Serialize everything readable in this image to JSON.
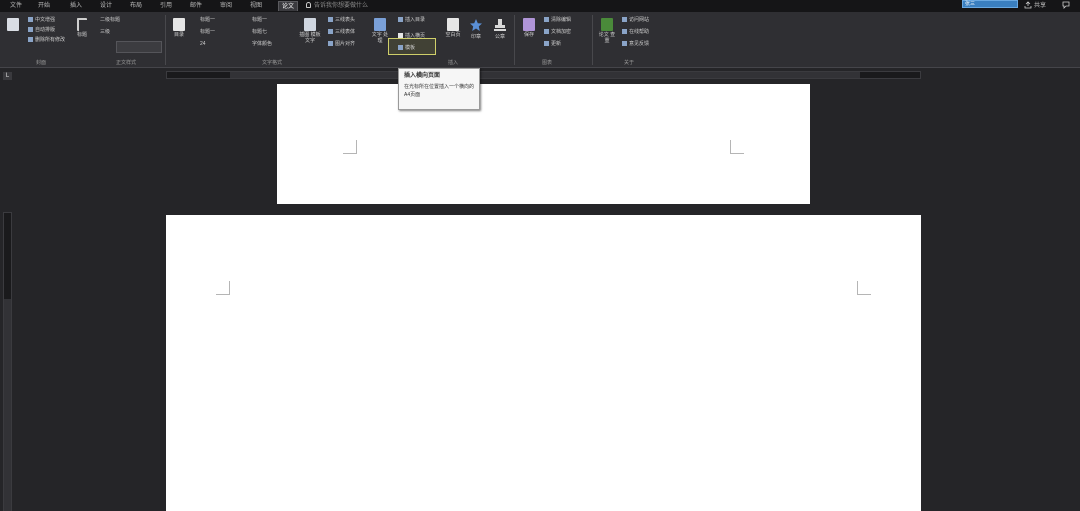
{
  "tabs": [
    {
      "label": "文件",
      "active": false
    },
    {
      "label": "开始",
      "active": false
    },
    {
      "label": "插入",
      "active": false
    },
    {
      "label": "设计",
      "active": false
    },
    {
      "label": "布局",
      "active": false
    },
    {
      "label": "引用",
      "active": false
    },
    {
      "label": "邮件",
      "active": false
    },
    {
      "label": "审阅",
      "active": false
    },
    {
      "label": "视图",
      "active": false
    },
    {
      "label": "论文",
      "active": true
    }
  ],
  "tell_me": "告诉我你想要做什么",
  "share": {
    "label": "共享",
    "user": "张三"
  },
  "ribbon": {
    "col1": {
      "big_label": "同源\n仿真",
      "items": [
        "中文增强",
        "自动排版",
        "删除所有修改"
      ]
    },
    "col2": {
      "big_label": "标题",
      "items": [
        "二级标题",
        "三级"
      ],
      "font_box": ""
    },
    "col3": {
      "big_label": "目录",
      "items": [
        "标题一",
        "标题一",
        "24"
      ]
    },
    "col4": {
      "items": [
        "标题一",
        "标题七",
        "字体颜色"
      ]
    },
    "col5": {
      "big_label": "插图\n模板文字",
      "items": [
        "三线表头",
        "三线表体",
        "图片对齐"
      ]
    },
    "col6": {
      "big_label": "文字\n处理",
      "items": [
        "插入目录",
        "插入横页",
        "模板"
      ],
      "highlight": "插入横页"
    },
    "col7": {
      "big_label": "空白页"
    },
    "col8": {
      "big_label": "印章"
    },
    "col9": {
      "big_label": "公章"
    },
    "col10": {
      "big_label": "保存",
      "items": [
        "清除编辑",
        "文档加密",
        "更新"
      ]
    },
    "col11": {
      "big_label": "论文\n查重",
      "items": [
        "访问网站",
        "在线帮助",
        "意见反馈"
      ]
    },
    "groups": [
      "封面",
      "正文样式",
      "文字格式",
      "插入",
      "图表",
      "关于"
    ]
  },
  "tooltip": {
    "title": "插入横向页面",
    "desc": "在光标所在位置插入一个横向的A4页面"
  },
  "ruler_corner": "L",
  "colors": {
    "background": "#252528",
    "ribbon": "#2f2f33",
    "tabbar": "#151517",
    "page": "#ffffff",
    "accent": "#3a7fc0"
  }
}
